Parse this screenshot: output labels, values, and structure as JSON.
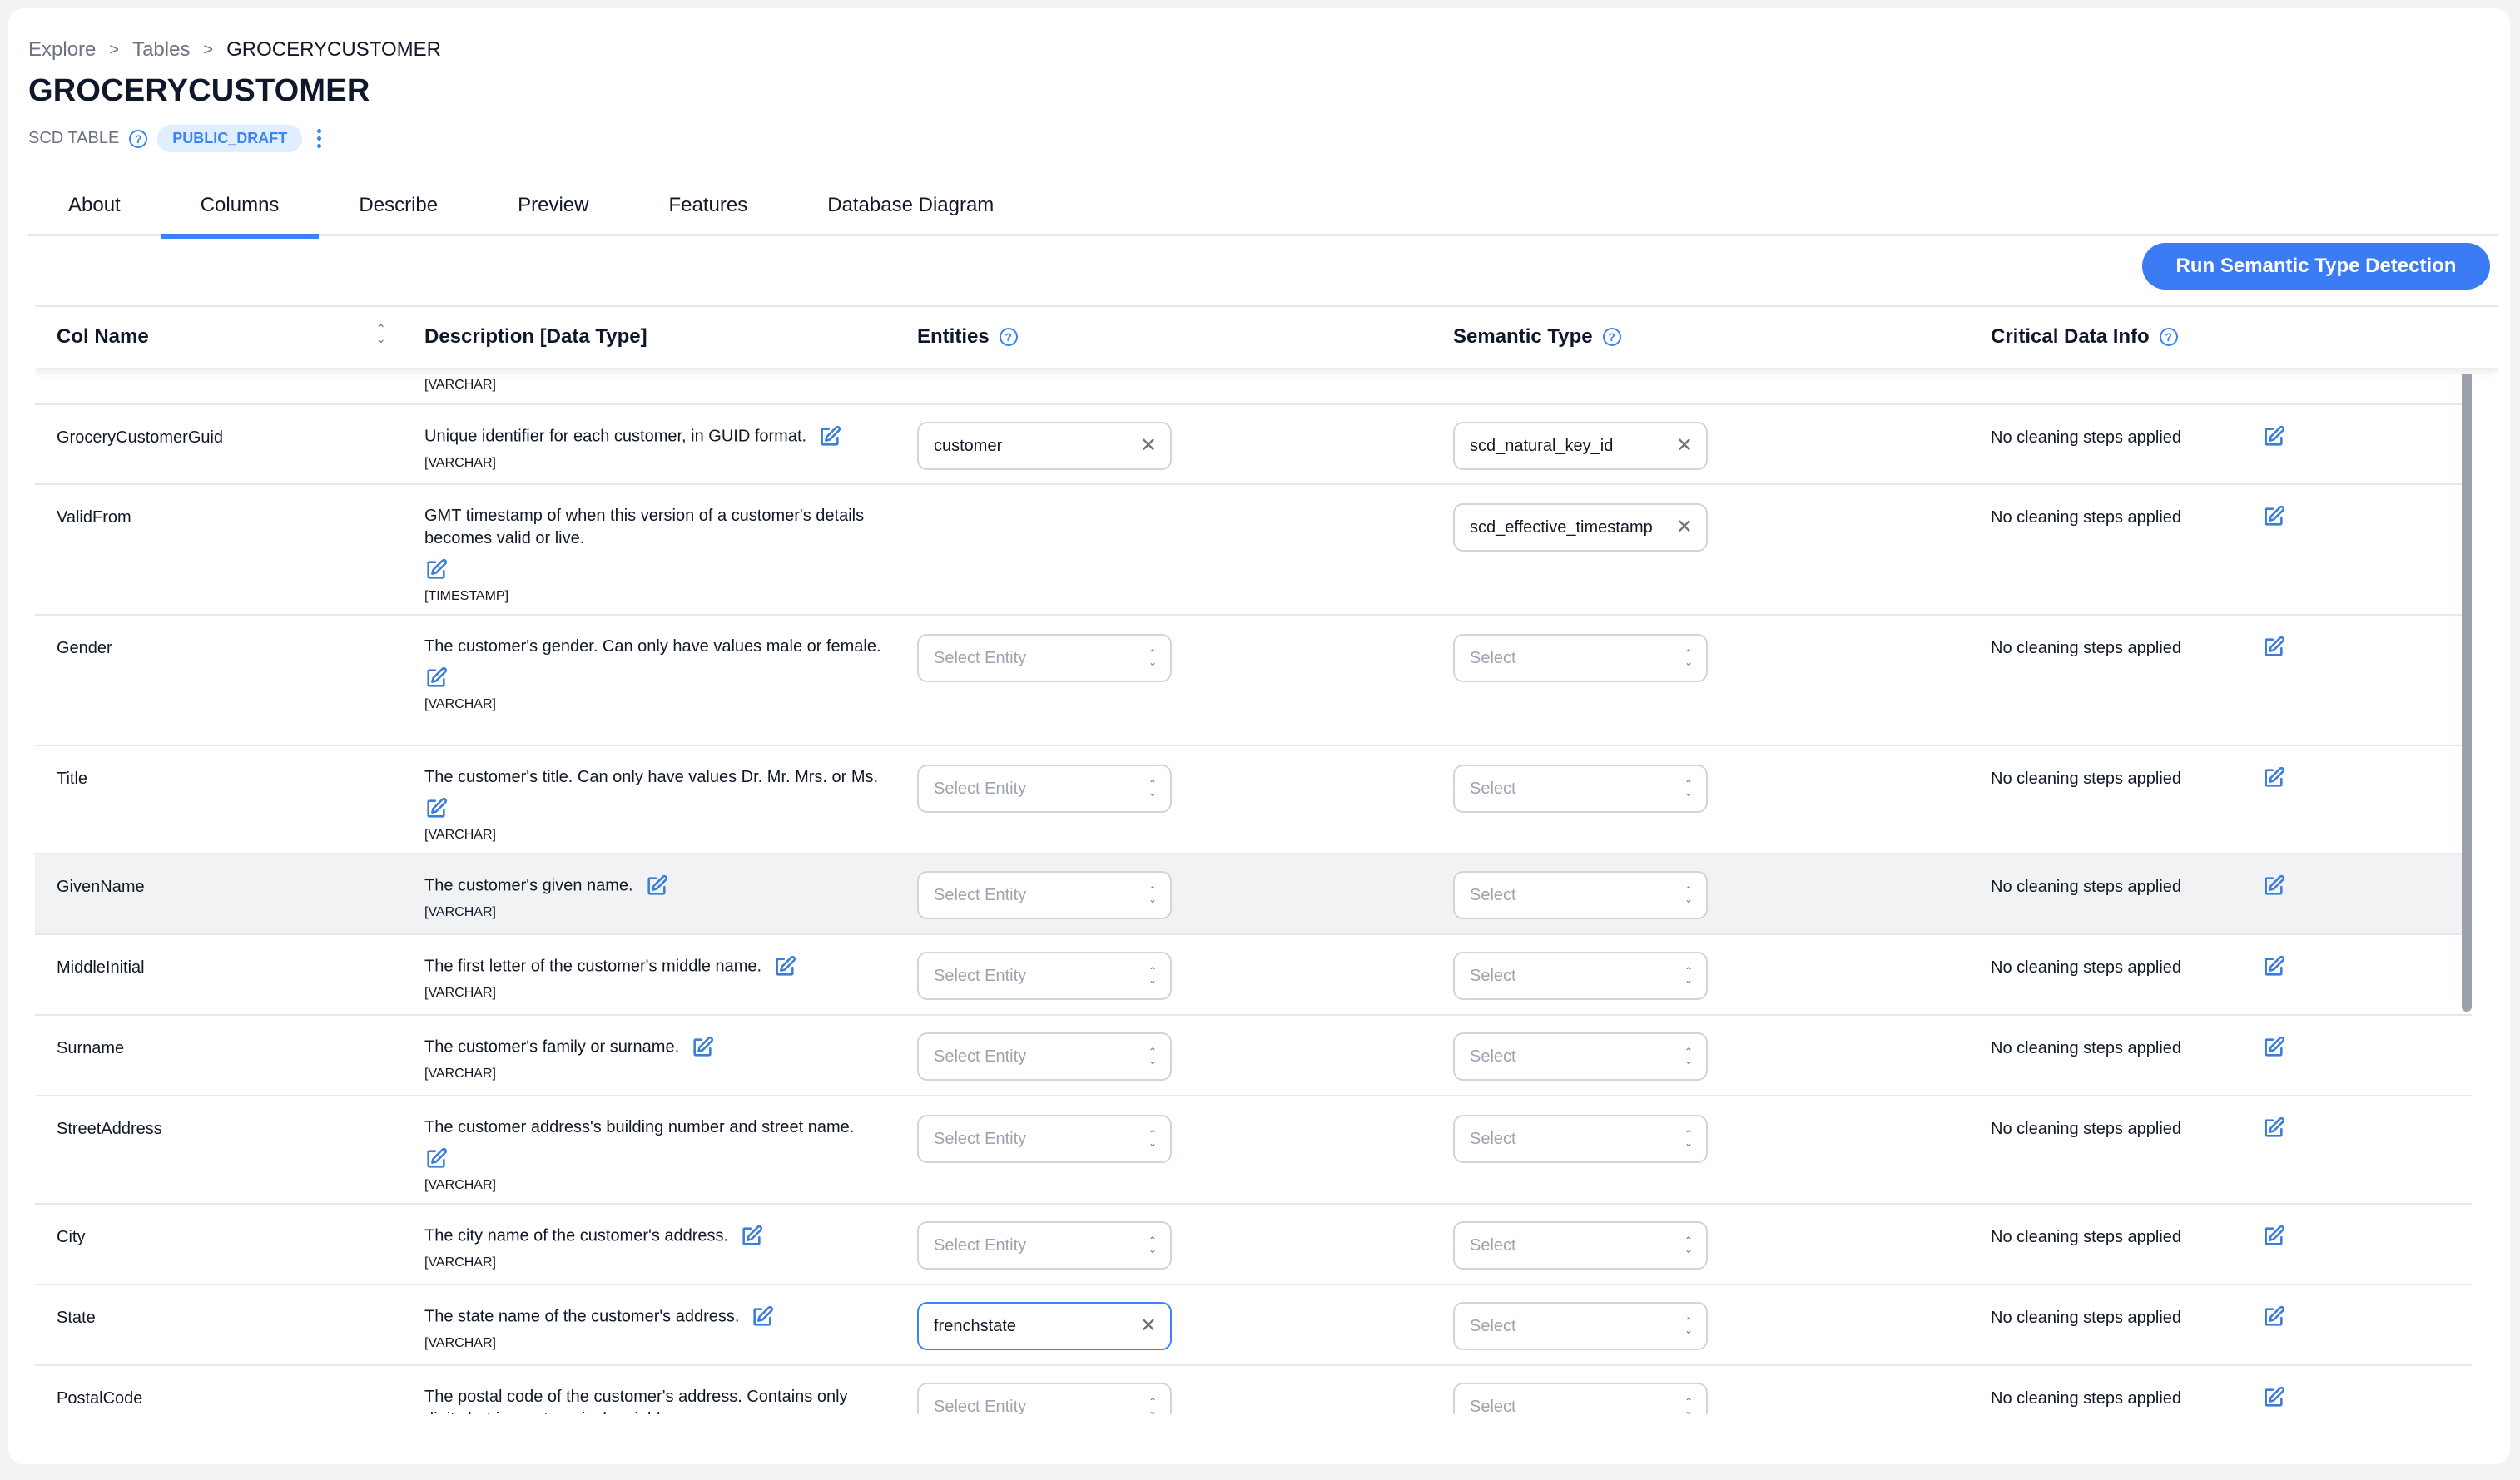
{
  "breadcrumb": [
    "Explore",
    "Tables",
    "GROCERYCUSTOMER"
  ],
  "breadcrumb_separator": ">",
  "page_title": "GROCERYCUSTOMER",
  "table_type": "SCD TABLE",
  "status_badge": "PUBLIC_DRAFT",
  "tabs": [
    {
      "label": "About",
      "active": false
    },
    {
      "label": "Columns",
      "active": true
    },
    {
      "label": "Describe",
      "active": false
    },
    {
      "label": "Preview",
      "active": false
    },
    {
      "label": "Features",
      "active": false
    },
    {
      "label": "Database Diagram",
      "active": false
    }
  ],
  "run_button_label": "Run Semantic Type Detection",
  "table": {
    "headers": {
      "col_name": "Col Name",
      "description": "Description [Data Type]",
      "entities": "Entities",
      "semantic_type": "Semantic Type",
      "critical_data_info": "Critical Data Info"
    },
    "partial_top_row": {
      "dtype": "[VARCHAR]"
    },
    "rows": [
      {
        "name": "GroceryCustomerGuid",
        "description": "Unique identifier for each customer, in GUID format.",
        "dtype": "[VARCHAR]",
        "entity": "customer",
        "semantic_type": "scd_natural_key_id",
        "critical": "No cleaning steps applied"
      },
      {
        "name": "ValidFrom",
        "description": "GMT timestamp of when this version of a customer's details becomes valid or live.",
        "dtype": "[TIMESTAMP]",
        "entity": null,
        "semantic_type": "scd_effective_timestamp",
        "critical": "No cleaning steps applied"
      },
      {
        "name": "Gender",
        "description": "The customer's gender. Can only have values male or female.",
        "dtype": "[VARCHAR]",
        "entity": "",
        "semantic_type": "",
        "critical": "No cleaning steps applied"
      },
      {
        "name": "Title",
        "description": "The customer's title. Can only have values Dr. Mr. Mrs. or Ms.",
        "dtype": "[VARCHAR]",
        "entity": "",
        "semantic_type": "",
        "critical": "No cleaning steps applied"
      },
      {
        "name": "GivenName",
        "description": "The customer's given name.",
        "dtype": "[VARCHAR]",
        "entity": "",
        "semantic_type": "",
        "critical": "No cleaning steps applied"
      },
      {
        "name": "MiddleInitial",
        "description": "The first letter of the customer's middle name.",
        "dtype": "[VARCHAR]",
        "entity": "",
        "semantic_type": "",
        "critical": "No cleaning steps applied"
      },
      {
        "name": "Surname",
        "description": "The customer's family or surname.",
        "dtype": "[VARCHAR]",
        "entity": "",
        "semantic_type": "",
        "critical": "No cleaning steps applied"
      },
      {
        "name": "StreetAddress",
        "description": "The customer address's building number and street name.",
        "dtype": "[VARCHAR]",
        "entity": "",
        "semantic_type": "",
        "critical": "No cleaning steps applied"
      },
      {
        "name": "City",
        "description": "The city name of the customer's address.",
        "dtype": "[VARCHAR]",
        "entity": "",
        "semantic_type": "",
        "critical": "No cleaning steps applied"
      },
      {
        "name": "State",
        "description": "The state name of the customer's address.",
        "dtype": "[VARCHAR]",
        "entity": "frenchstate",
        "semantic_type": "",
        "critical": "No cleaning steps applied"
      },
      {
        "name": "PostalCode",
        "description": "The postal code of the customer's address. Contains only digits but is a categorical variable.",
        "dtype": "",
        "entity": "",
        "semantic_type": "",
        "critical": "No cleaning steps applied"
      }
    ],
    "entity_placeholder": "Select Entity",
    "semantic_placeholder": "Select"
  },
  "colors": {
    "accent": "#3b82f6",
    "button": "#3b7cf5",
    "badge_bg": "#e0efff"
  }
}
